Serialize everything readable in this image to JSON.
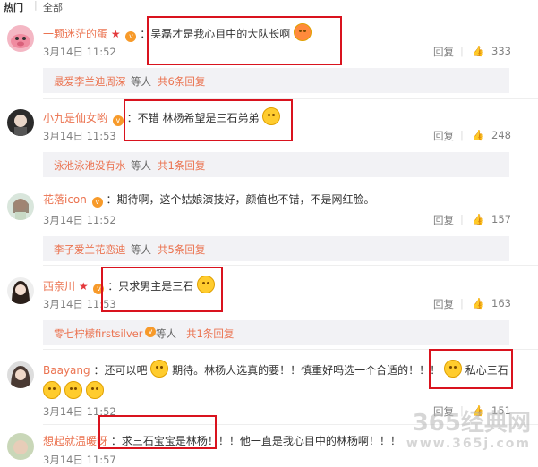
{
  "tabs": {
    "hot": "热门",
    "all": "全部"
  },
  "comments": [
    {
      "user": "一颗迷茫的蛋",
      "text": "：吴磊才是我心目中的大队长啊",
      "time": "3月14日 11:52",
      "reply": "回复",
      "likes": "333",
      "sub_user": "最爱李兰迪周深",
      "sub_mid": " 等人 ",
      "sub_count": "共6条回复"
    },
    {
      "user": "小九是仙女哟",
      "text": "：不错 林杨希望是三石弟弟",
      "time": "3月14日 11:53",
      "reply": "回复",
      "likes": "248",
      "sub_user": "泳池泳池没有水",
      "sub_mid": " 等人 ",
      "sub_count": "共1条回复"
    },
    {
      "user": "花落icon",
      "text": "：期待啊，这个姑娘演技好，颜值也不错，不是网红脸。",
      "time": "3月14日 11:52",
      "reply": "回复",
      "likes": "157",
      "sub_user": "李子爱兰花恋迪",
      "sub_mid": " 等人 ",
      "sub_count": "共5条回复"
    },
    {
      "user": "西亲川",
      "text": "：只求男主是三石",
      "time": "3月14日 11:53",
      "reply": "回复",
      "likes": "163",
      "sub_user": "零七柠檬firstsilver",
      "sub_mid": " 等人 ",
      "sub_count": "共1条回复"
    },
    {
      "user": "Baayang",
      "text_a": "：还可以吧",
      "text_b": "期待。林杨人选真的要！！慎重好吗选一个合适的！！！",
      "text_c": "私心三石",
      "time": "3月14日 11:52",
      "reply": "回复",
      "likes": "151"
    },
    {
      "user": "想起就温暖呀",
      "text": "：求三石宝宝是林杨！！！他一直是我心目中的林杨啊！！！",
      "time": "3月14日 11:57"
    }
  ],
  "watermark": {
    "main": "365经典网",
    "url": "www.365j.com"
  },
  "colors": {
    "username": "#eb7350",
    "highlight_box": "#d9131e",
    "meta": "#808080"
  }
}
